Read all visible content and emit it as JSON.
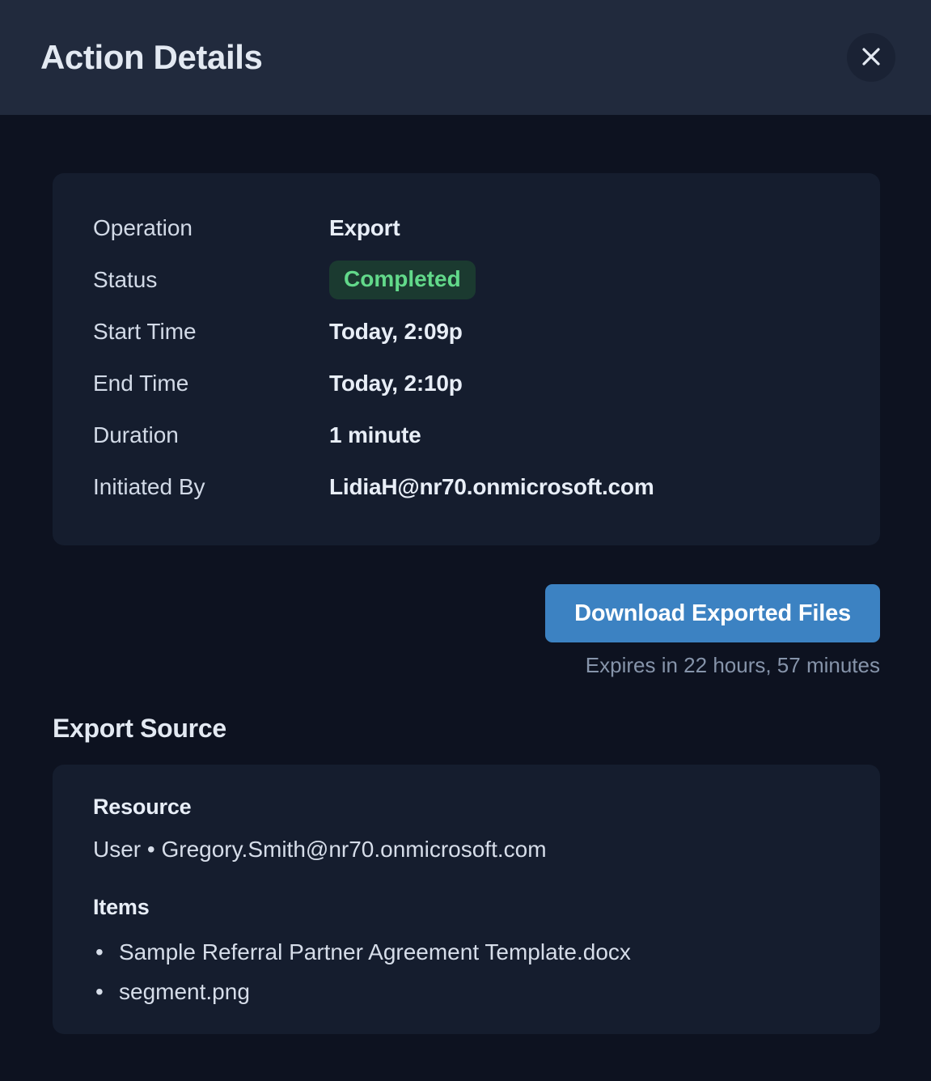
{
  "header": {
    "title": "Action Details",
    "close_icon": "close-icon"
  },
  "details": {
    "rows": [
      {
        "label": "Operation",
        "value": "Export",
        "type": "text"
      },
      {
        "label": "Status",
        "value": "Completed",
        "type": "badge"
      },
      {
        "label": "Start Time",
        "value": "Today, 2:09p",
        "type": "text"
      },
      {
        "label": "End Time",
        "value": "Today, 2:10p",
        "type": "text"
      },
      {
        "label": "Duration",
        "value": "1 minute",
        "type": "text"
      },
      {
        "label": "Initiated By",
        "value": "LidiaH@nr70.onmicrosoft.com",
        "type": "text"
      }
    ]
  },
  "download": {
    "button_label": "Download Exported Files",
    "expires_text": "Expires in 22 hours, 57 minutes"
  },
  "export_source": {
    "section_title": "Export Source",
    "resource_heading": "Resource",
    "resource_value": "User • Gregory.Smith@nr70.onmicrosoft.com",
    "items_heading": "Items",
    "items": [
      "Sample Referral Partner Agreement Template.docx",
      "segment.png"
    ]
  },
  "colors": {
    "header_bg": "#212a3d",
    "body_bg": "#0d1220",
    "card_bg": "#151d2e",
    "accent_blue": "#3c82c2",
    "status_green_text": "#62d98a",
    "status_green_bg": "#1b3a30",
    "muted_text": "#8694aa",
    "primary_text": "#e8eef7"
  }
}
